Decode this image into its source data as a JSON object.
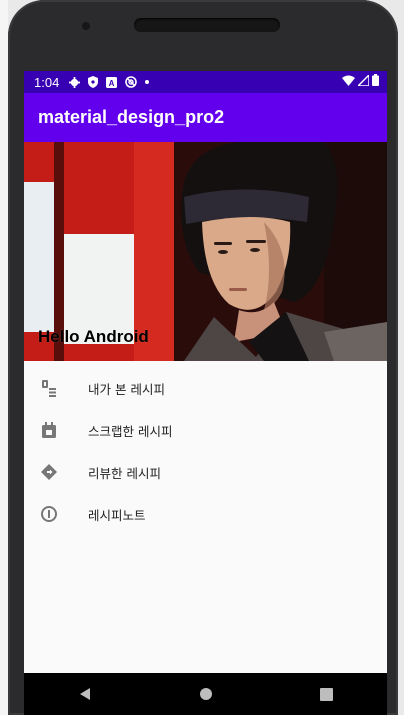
{
  "status_bar": {
    "time": "1:04",
    "icons": [
      "gear-icon",
      "shield-icon",
      "a-box-icon",
      "circle-at-icon",
      "dot-icon"
    ],
    "right_icons": [
      "wifi-icon",
      "signal-icon",
      "battery-icon"
    ]
  },
  "app_bar": {
    "title": "material_design_pro2",
    "color": "#6200ee",
    "status_color": "#3700b3"
  },
  "drawer_header": {
    "title": "Hello Android",
    "image": "portrait-photo"
  },
  "menu": {
    "items": [
      {
        "label": "내가 본 레시피",
        "icon": "viewed-list-icon"
      },
      {
        "label": "스크랩한 레시피",
        "icon": "calendar-scrap-icon"
      },
      {
        "label": "리뷰한 레시피",
        "icon": "diamond-directions-icon"
      },
      {
        "label": "레시피노트",
        "icon": "info-circle-icon"
      }
    ]
  },
  "nav_bar": {
    "buttons": [
      "back-icon",
      "home-icon",
      "recents-icon"
    ]
  }
}
